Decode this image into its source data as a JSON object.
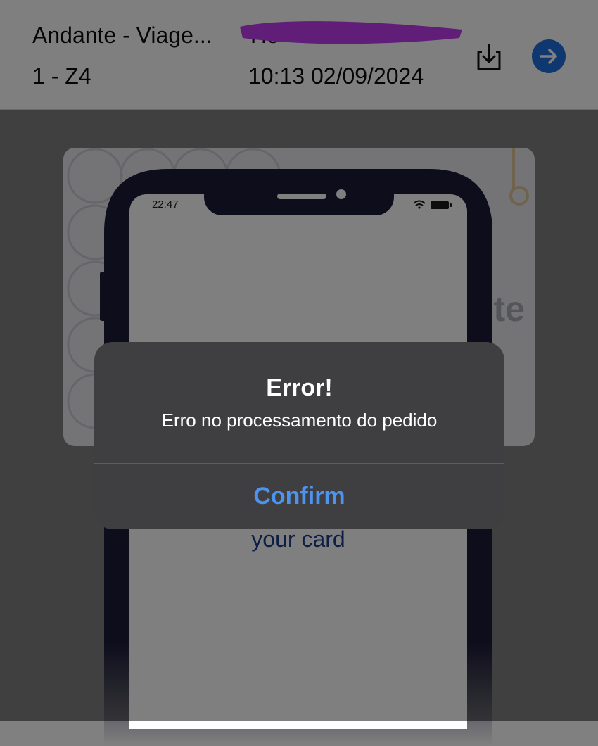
{
  "header": {
    "product_name": "Andante - Viage...",
    "zone": "1 - Z4",
    "label_fragment": "Ho",
    "datetime": "10:13 02/09/2024",
    "download_icon": "download-icon",
    "go_icon": "arrow-right-circle-icon"
  },
  "card": {
    "brand_fragment": "te"
  },
  "phone_illustration": {
    "time": "22:47",
    "status_icons": [
      "wifi-icon",
      "battery-icon"
    ]
  },
  "instruction": {
    "text": "your card"
  },
  "alert": {
    "title": "Error!",
    "message": "Erro no processamento do pedido",
    "confirm_label": "Confirm"
  },
  "colors": {
    "accent": "#4e93ee",
    "go_button": "#1f6fe0",
    "redaction": "#c03cf2",
    "phone_frame": "#1c1b38",
    "instruction_text": "#1a3f8e"
  }
}
